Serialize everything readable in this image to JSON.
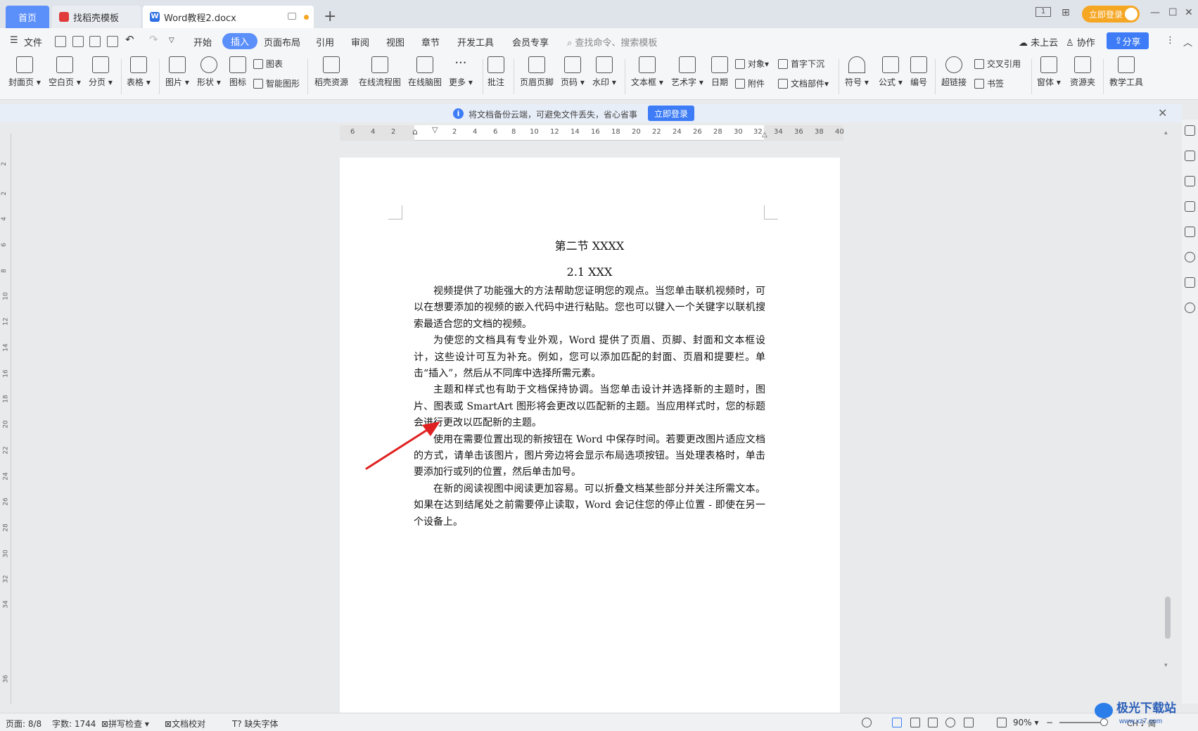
{
  "tabs": {
    "home": "首页",
    "template": "找稻壳模板",
    "document": "Word教程2.docx",
    "doc_icon_letter": "W"
  },
  "titlebar": {
    "login": "立即登录",
    "page_indicator": "1"
  },
  "menu": {
    "file": "文件",
    "items": [
      "开始",
      "插入",
      "页面布局",
      "引用",
      "审阅",
      "视图",
      "章节",
      "开发工具",
      "会员专享"
    ],
    "active": "插入",
    "search_placeholder": "查找命令、搜索模板",
    "cloud": "未上云",
    "collab": "协作",
    "share": "分享"
  },
  "ribbon": {
    "cover": "封面页",
    "blank": "空白页",
    "page_break": "分页",
    "table": "表格",
    "picture": "图片",
    "shape": "形状",
    "icon": "图标",
    "chart": "图表",
    "smart_art": "智能图形",
    "docer": "稻壳资源",
    "flowchart": "在线流程图",
    "mindmap": "在线脑图",
    "more": "更多",
    "comment": "批注",
    "header_footer": "页眉页脚",
    "page_num": "页码",
    "watermark": "水印",
    "textbox": "文本框",
    "wordart": "艺术字",
    "date": "日期",
    "object": "对象",
    "attachment": "附件",
    "drop_cap": "首字下沉",
    "doc_parts": "文档部件",
    "symbol": "符号",
    "formula": "公式",
    "numbering": "编号",
    "hyperlink": "超链接",
    "cross_ref": "交叉引用",
    "bookmark": "书签",
    "window": "窗体",
    "resource": "资源夹",
    "teaching": "教学工具"
  },
  "infobar": {
    "text": "将文档备份云端，可避免文件丢失，省心省事",
    "button": "立即登录"
  },
  "ruler": {
    "h_ticks": [
      "6",
      "4",
      "2",
      "2",
      "4",
      "6",
      "8",
      "10",
      "12",
      "14",
      "16",
      "18",
      "20",
      "22",
      "24",
      "26",
      "28",
      "30",
      "32",
      "34",
      "36",
      "38",
      "40"
    ],
    "v_ticks": [
      "2",
      "2",
      "4",
      "6",
      "8",
      "10",
      "12",
      "14",
      "16",
      "18",
      "20",
      "22",
      "24",
      "26",
      "28",
      "30",
      "32",
      "34",
      "36"
    ]
  },
  "document": {
    "section_title": "第二节 XXXX",
    "subsection_title": "2.1 XXX",
    "paragraphs": [
      "视频提供了功能强大的方法帮助您证明您的观点。当您单击联机视频时，可以在想要添加的视频的嵌入代码中进行粘贴。您也可以键入一个关键字以联机搜索最适合您的文档的视频。",
      "为使您的文档具有专业外观，Word 提供了页眉、页脚、封面和文本框设计，这些设计可互为补充。例如，您可以添加匹配的封面、页眉和提要栏。单击“插入”，然后从不同库中选择所需元素。",
      "主题和样式也有助于文档保持协调。当您单击设计并选择新的主题时，图片、图表或 SmartArt 图形将会更改以匹配新的主题。当应用样式时，您的标题会进行更改以匹配新的主题。",
      "使用在需要位置出现的新按钮在 Word 中保存时间。若要更改图片适应文档的方式，请单击该图片，图片旁边将会显示布局选项按钮。当处理表格时，单击要添加行或列的位置，然后单击加号。",
      "在新的阅读视图中阅读更加容易。可以折叠文档某些部分并关注所需文本。如果在达到结尾处之前需要停止读取，Word 会记住您的停止位置 - 即使在另一个设备上。"
    ]
  },
  "status": {
    "page": "页面: 8/8",
    "words": "字数: 1744",
    "spell": "拼写检查",
    "proofread": "文档校对",
    "missing_font": "缺失字体",
    "zoom": "90%",
    "ime": "CH ♪ 简"
  },
  "watermark": {
    "text": "极光下载站",
    "url": "www.xz7.com"
  },
  "colors": {
    "accent": "#3d7cf6",
    "tab_active": "#5b8ff9",
    "login": "#f5a623",
    "arrow": "#e02020"
  }
}
